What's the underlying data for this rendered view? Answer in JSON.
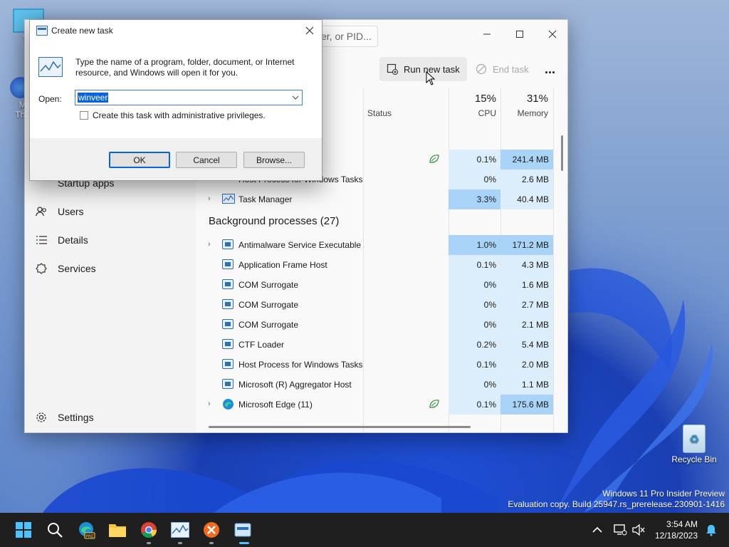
{
  "desktop": {
    "icons": [
      {
        "label": "Th",
        "icon": "this-pc-icon"
      },
      {
        "label": "Mo",
        "icon": "thunderbird-icon"
      },
      {
        "label": "Thun",
        "icon": "thunderbird-label"
      },
      {
        "label": "Recycle Bin",
        "icon": "recycle-bin-icon"
      }
    ],
    "watermark": {
      "line1": "Windows 11 Pro Insider Preview",
      "line2": "Evaluation copy. Build 25947.rs_prerelease.230901-1416"
    }
  },
  "task_manager": {
    "search_placeholder": "er, or PID...",
    "toolbar": {
      "run_new_task": "Run new task",
      "end_task": "End task",
      "more": "..."
    },
    "sidebar": {
      "items": [
        {
          "label": "Startup apps",
          "icon": "startup-apps-icon"
        },
        {
          "label": "Users",
          "icon": "users-icon"
        },
        {
          "label": "Details",
          "icon": "details-icon"
        },
        {
          "label": "Services",
          "icon": "services-icon"
        }
      ],
      "settings": "Settings"
    },
    "columns": {
      "status": "Status",
      "cpu_pct": "15%",
      "cpu": "CPU",
      "mem_pct": "31%",
      "memory": "Memory"
    },
    "app_rows": [
      {
        "name": "",
        "cpu": "0.1%",
        "mem": "241.4 MB",
        "eco": true
      },
      {
        "name": "Host Process for Windows Tasks",
        "cpu": "0%",
        "mem": "2.6 MB",
        "eco": false
      },
      {
        "name": "Task Manager",
        "cpu": "3.3%",
        "mem": "40.4 MB",
        "eco": false,
        "expandable": true
      }
    ],
    "background_title": "Background processes (27)",
    "bg_rows": [
      {
        "name": "Antimalware Service Executable",
        "cpu": "1.0%",
        "mem": "171.2 MB",
        "expandable": true
      },
      {
        "name": "Application Frame Host",
        "cpu": "0.1%",
        "mem": "4.3 MB"
      },
      {
        "name": "COM Surrogate",
        "cpu": "0%",
        "mem": "1.6 MB"
      },
      {
        "name": "COM Surrogate",
        "cpu": "0%",
        "mem": "2.7 MB"
      },
      {
        "name": "COM Surrogate",
        "cpu": "0%",
        "mem": "2.1 MB"
      },
      {
        "name": "CTF Loader",
        "cpu": "0.2%",
        "mem": "5.4 MB"
      },
      {
        "name": "Host Process for Windows Tasks",
        "cpu": "0.1%",
        "mem": "2.0 MB"
      },
      {
        "name": "Microsoft (R) Aggregator Host",
        "cpu": "0%",
        "mem": "1.1 MB"
      },
      {
        "name": "Microsoft Edge (11)",
        "cpu": "0.1%",
        "mem": "175.6 MB",
        "expandable": true,
        "eco": true
      }
    ]
  },
  "dialog": {
    "title": "Create new task",
    "description": "Type the name of a program, folder, document, or Internet resource, and Windows will open it for you.",
    "open_label": "Open:",
    "open_value": "winveer",
    "admin_checkbox": "Create this task with administrative privileges.",
    "admin_checked": false,
    "ok": "OK",
    "cancel": "Cancel",
    "browse": "Browse..."
  },
  "taskbar": {
    "apps": [
      "start-icon",
      "search-icon",
      "edge-beta-icon",
      "file-explorer-icon",
      "chrome-icon",
      "task-manager-icon",
      "xampp-icon",
      "run-dialog-icon"
    ],
    "time": "3:54 AM",
    "date": "12/18/2023"
  },
  "colors": {
    "accent": "#0a64d8",
    "heat_low": "#dceefc",
    "heat_mid": "#c6e3fb",
    "heat_high": "#a9d4f8",
    "taskbar": "#1f1f1f"
  }
}
